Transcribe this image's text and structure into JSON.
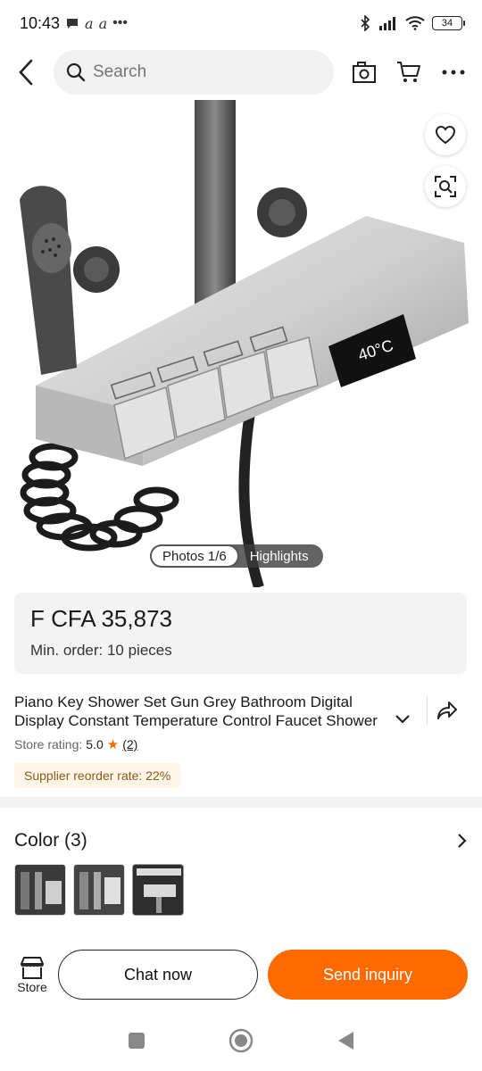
{
  "status_bar": {
    "time": "10:43",
    "notif_icons": [
      "chat-bubble-icon",
      "handwriting-icon",
      "handwriting-icon",
      "more-dots-icon"
    ],
    "battery": "34"
  },
  "nav": {
    "search_placeholder": "Search"
  },
  "gallery": {
    "photos_label": "Photos 1/6",
    "highlights_label": "Highlights",
    "display_temp": "40°C"
  },
  "price": {
    "amount": "F CFA 35,873",
    "min_order": "Min. order: 10 pieces"
  },
  "product": {
    "title_line1": "Piano Key Shower Set Gun Grey Bathroom Digital",
    "title_line2": "Display Constant Temperature Control Faucet Shower",
    "rating_label": "Store rating:",
    "rating_value": "5.0",
    "rating_count": "(2)",
    "reorder_rate": "Supplier reorder rate: 22%"
  },
  "color": {
    "label": "Color (3)",
    "swatch_count": 3
  },
  "bottom_bar": {
    "store_label": "Store",
    "chat_label": "Chat now",
    "inquiry_label": "Send inquiry"
  },
  "colors": {
    "accent": "#ff6a00",
    "reorder_bg": "#fff6e8",
    "reorder_text": "#8a5a1c"
  }
}
